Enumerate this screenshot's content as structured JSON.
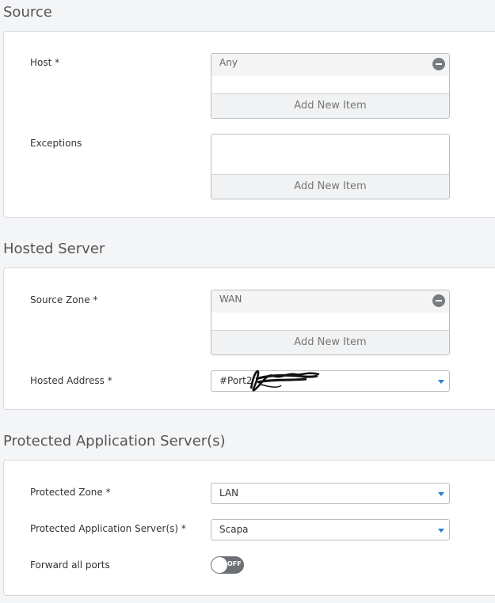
{
  "source": {
    "title": "Source",
    "host": {
      "label": "Host *",
      "items": [
        "Any"
      ],
      "add_label": "Add New Item"
    },
    "exceptions": {
      "label": "Exceptions",
      "add_label": "Add New Item"
    }
  },
  "hosted_server": {
    "title": "Hosted Server",
    "source_zone": {
      "label": "Source Zone *",
      "items": [
        "WAN"
      ],
      "add_label": "Add New Item"
    },
    "hosted_address": {
      "label": "Hosted Address *",
      "value": "#Port2"
    }
  },
  "protected": {
    "title": "Protected Application Server(s)",
    "zone": {
      "label": "Protected Zone *",
      "value": "LAN"
    },
    "servers": {
      "label": "Protected Application Server(s) *",
      "value": "Scapa"
    },
    "forward_ports": {
      "label": "Forward all ports",
      "toggle_text": "OFF",
      "state": "off"
    }
  },
  "colors": {
    "caret": "#2a7fd4",
    "toggle_off": "#6c7075",
    "panel_bg": "#ffffff",
    "page_bg": "#f4f5f7"
  }
}
